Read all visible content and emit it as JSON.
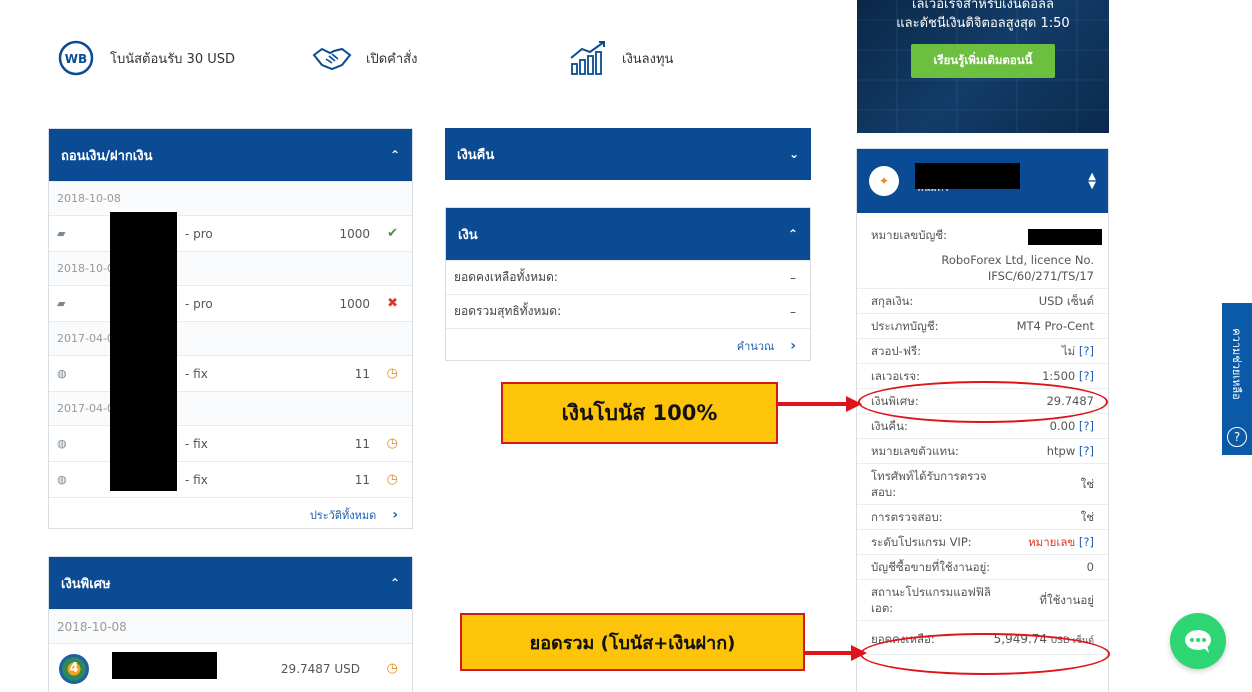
{
  "features": [
    {
      "icon": "wb-logo-icon",
      "label": "โบนัสต้อนรับ 30 USD"
    },
    {
      "icon": "handshake-icon",
      "label": "เปิดคำสั่ง"
    },
    {
      "icon": "growth-chart-icon",
      "label": "เงินลงทุน"
    }
  ],
  "banner": {
    "line1": "เลเวอเรจสำหรับเงินดอลล",
    "line2": "และดัชนีเงินดิจิตอลสูงสุด 1:50",
    "button": "เรียนรู้เพิ่มเติมตอนนี้"
  },
  "withdraw_panel": {
    "title": "ถอนเงิน/ฝากเงิน",
    "groups": [
      {
        "date": "2018-10-08",
        "rows": [
          {
            "name": "- pro",
            "amount": "1000",
            "status": "ok"
          }
        ]
      },
      {
        "date": "2018-10-0",
        "rows": [
          {
            "name": "- pro",
            "amount": "1000",
            "status": "bad"
          }
        ]
      },
      {
        "date": "2017-04-0",
        "rows": [
          {
            "name": "- fix",
            "amount": "11",
            "status": "pend"
          }
        ]
      },
      {
        "date": "2017-04-0",
        "rows": [
          {
            "name": "- fix",
            "amount": "11",
            "status": "pend"
          },
          {
            "name": "- fix",
            "amount": "11",
            "status": "pend"
          }
        ]
      }
    ],
    "footer_link": "ประวัติทั้งหมด"
  },
  "bonus_panel": {
    "title": "เงินพิเศษ",
    "date": "2018-10-08",
    "amount": "29.7487 USD"
  },
  "refund_panel": {
    "title": "เงินคืน"
  },
  "money_panel": {
    "title": "เงิน",
    "rows": [
      {
        "label": "ยอดคงเหลือทั้งหมด:",
        "value": "–"
      },
      {
        "label": "ยอดรวมสุทธิทั้งหมด:",
        "value": "–"
      }
    ],
    "footer_link": "คำนวณ"
  },
  "account": {
    "header_sub": "พนมคร",
    "rows": [
      {
        "label": "หมายเลขบัญชี:",
        "value": ""
      },
      {
        "label": "",
        "value": "RoboForex Ltd, licence No. IFSC/60/271/TS/17"
      },
      {
        "label": "สกุลเงิน:",
        "value": "USD เซ็นต์"
      },
      {
        "label": "ประเภทบัญชี:",
        "value": "MT4 Pro-Cent"
      },
      {
        "label": "สวอป-ฟรี:",
        "value": "ไม่",
        "q": "[?]"
      },
      {
        "label": "เลเวอเรจ:",
        "value": "1:500",
        "q": "[?]"
      },
      {
        "label": "เงินพิเศษ:",
        "value": "29.7487",
        "cls": "blue"
      },
      {
        "label": "เงินคืน:",
        "value": "0.00",
        "q": "[?]"
      },
      {
        "label": "หมายเลขตัวแทน:",
        "value": "htpw",
        "q": "[?]"
      },
      {
        "label": "โทรศัพท์ได้รับการตรวจสอบ:",
        "value": "ใช่",
        "cls": "green"
      },
      {
        "label": "การตรวจสอบ:",
        "value": "ใช่",
        "cls": "green"
      },
      {
        "label": "ระดับโปรแกรม VIP:",
        "value": "หมายเลข",
        "cls": "red",
        "q": "[?]"
      },
      {
        "label": "บัญชีซื้อขายที่ใช้งานอยู่:",
        "value": "0"
      },
      {
        "label": "สถานะโปรแกรมแอฟฟิลิเอต:",
        "value": "ที่ใช้งานอยู่",
        "cls": "green"
      },
      {
        "label": "ยอดคงเหลือ:",
        "value": "5,949.74",
        "unit": "USD เซ็นต์"
      }
    ]
  },
  "annotations": {
    "bonus": "เงินโบนัส 100%",
    "total": "ยอดรวม (โบนัส+เงินฝาก)"
  },
  "side_tab": {
    "label": "ความช่วยเหลือ",
    "icon": "question-icon"
  }
}
